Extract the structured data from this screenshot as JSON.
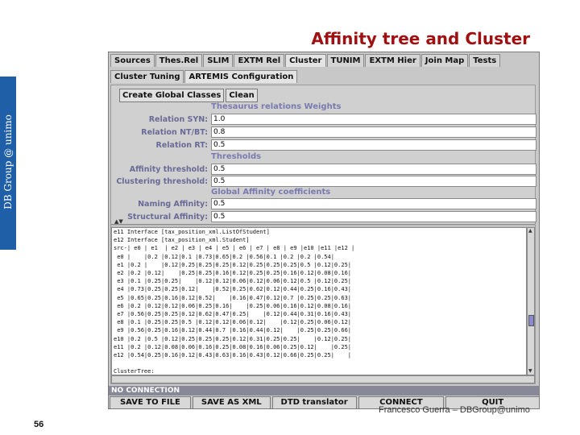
{
  "side_label": "DB Group @ unimo",
  "slide_title": "Affinity tree and Cluster",
  "author": "Francesco Guerra – DBGroup@unimo",
  "page_number": "56",
  "app": {
    "main_tabs": [
      {
        "label": "Sources",
        "active": false
      },
      {
        "label": "Thes.Rel",
        "active": false
      },
      {
        "label": "SLIM",
        "active": false
      },
      {
        "label": "EXTM Rel",
        "active": false
      },
      {
        "label": "Cluster",
        "active": true
      },
      {
        "label": "TUNIM",
        "active": false
      },
      {
        "label": "EXTM Hier",
        "active": false
      },
      {
        "label": "Join Map",
        "active": false
      },
      {
        "label": "Tests",
        "active": false
      }
    ],
    "sub_tabs": [
      {
        "label": "Cluster Tuning",
        "active": false
      },
      {
        "label": "ARTEMIS Configuration",
        "active": true
      }
    ],
    "toolbar": {
      "create_label": "Create Global Classes",
      "clean_label": "Clean"
    },
    "form": {
      "section_thesaurus": "Thesaurus relations Weights",
      "syn_label": "Relation SYN:",
      "syn_value": "1.0",
      "nt_label": "Relation NT/BT:",
      "nt_value": "0.8",
      "rt_label": "Relation RT:",
      "rt_value": "0.5",
      "section_thresholds": "Thresholds",
      "affinity_label": "Affinity threshold:",
      "affinity_value": "0.5",
      "clustering_label": "Clustering threshold:",
      "clustering_value": "0.5",
      "section_global": "Global Affinity coefficients",
      "naming_label": "Naming Affinity:",
      "naming_value": "0.5",
      "structural_label": "Structural Affinity:",
      "structural_value": "0.5"
    },
    "output_text": "e11 Interface [tax_position_xml.ListOfStudent]\ne12 Interface [tax_position_xml.Student]\nsrc-| e0 | e1  | e2 | e3 | e4 | e5 | e6 | e7 | e8 | e9 |e10 |e11 |e12 |\n e0 |    |0.2 |0.12|0.1 |0.73|0.65|0.2 |0.56|0.1 |0.2 |0.2 |0.54|\n e1 |0.2 |    |0.12|0.25|0.25|0.25|0.12|0.25|0.25|0.25|0.5 |0.12|0.25|\n e2 |0.2 |0.12|    |0.25|0.25|0.16|0.12|0.25|0.25|0.16|0.12|0.08|0.16|\n e3 |0.1 |0.25|0.25|    |0.12|0.12|0.06|0.12|0.06|0.12|0.5 |0.12|0.25|\n e4 |0.73|0.25|0.25|0.12|    |0.52|0.25|0.62|0.12|0.44|0.25|0.16|0.43|\n e5 |0.65|0.25|0.16|0.12|0.52|    |0.16|0.47|0.12|0.7 |0.25|0.25|0.63|\n e6 |0.2 |0.12|0.12|0.06|0.25|0.16|    |0.25|0.06|0.16|0.12|0.08|0.16|\n e7 |0.56|0.25|0.25|0.12|0.62|0.47|0.25|    |0.12|0.44|0.31|0.16|0.43|\n e8 |0.1 |0.25|0.25|0.5 |0.12|0.12|0.06|0.12|    |0.12|0.25|0.06|0.12|\n e9 |0.56|0.25|0.16|0.12|0.44|0.7 |0.16|0.44|0.12|    |0.25|0.25|0.66|\ne10 |0.2 |0.5 |0.12|0.25|0.25|0.25|0.12|0.31|0.25|0.25|    |0.12|0.25|\ne11 |0.2 |0.12|0.08|0.06|0.16|0.25|0.08|0.16|0.06|0.25|0.12|    |0.25|\ne12 |0.54|0.25|0.16|0.12|0.43|0.63|0.16|0.43|0.12|0.66|0.25|0.25|    |\n\nClusterTree:",
    "status_text": "NO CONNECTION",
    "bottom_buttons": {
      "save_file": "SAVE TO FILE",
      "save_xml": "SAVE AS XML",
      "dtd": "DTD translator",
      "connect": "CONNECT",
      "quit": "QUIT"
    }
  }
}
